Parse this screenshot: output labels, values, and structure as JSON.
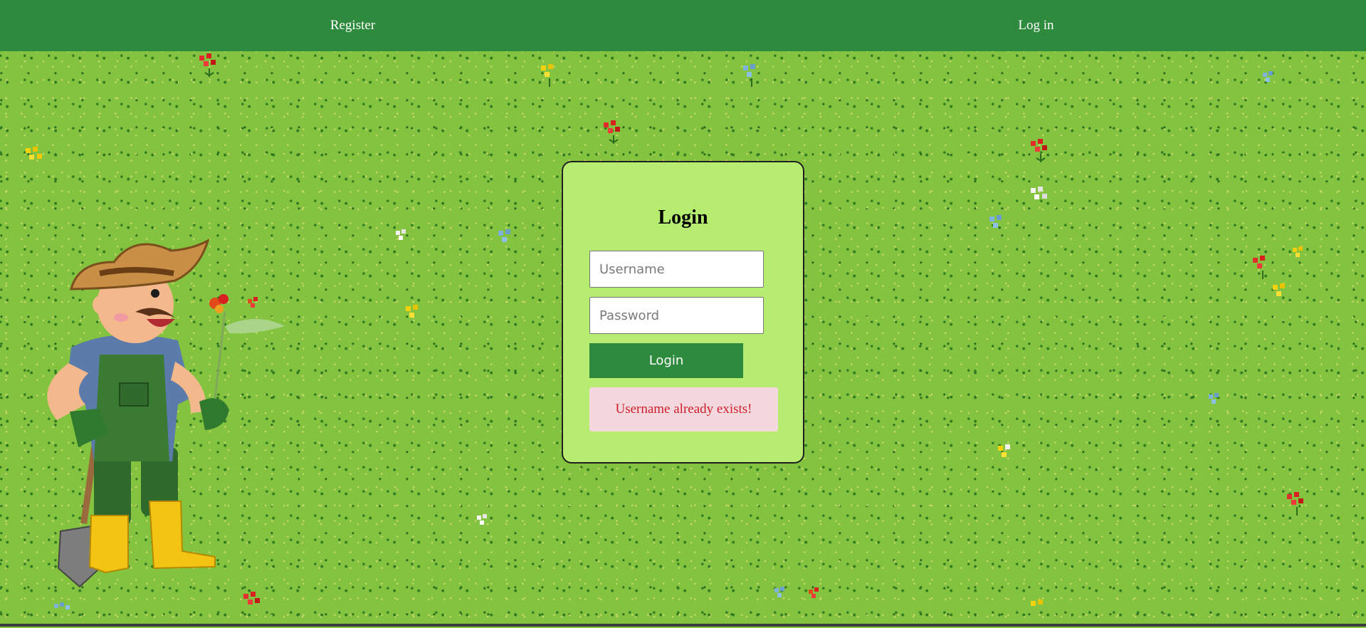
{
  "nav": {
    "register_label": "Register",
    "login_label": "Log in",
    "background_color": "#2e8b3d"
  },
  "login": {
    "title": "Login",
    "username_placeholder": "Username",
    "password_placeholder": "Password",
    "submit_label": "Login",
    "error_message": "Username already exists!",
    "card_color": "#b6ec6f",
    "error_color": "#d01c2b"
  },
  "background": {
    "grass_color": "#84c33f",
    "illustration": "farmer-with-shovel-and-flower"
  }
}
